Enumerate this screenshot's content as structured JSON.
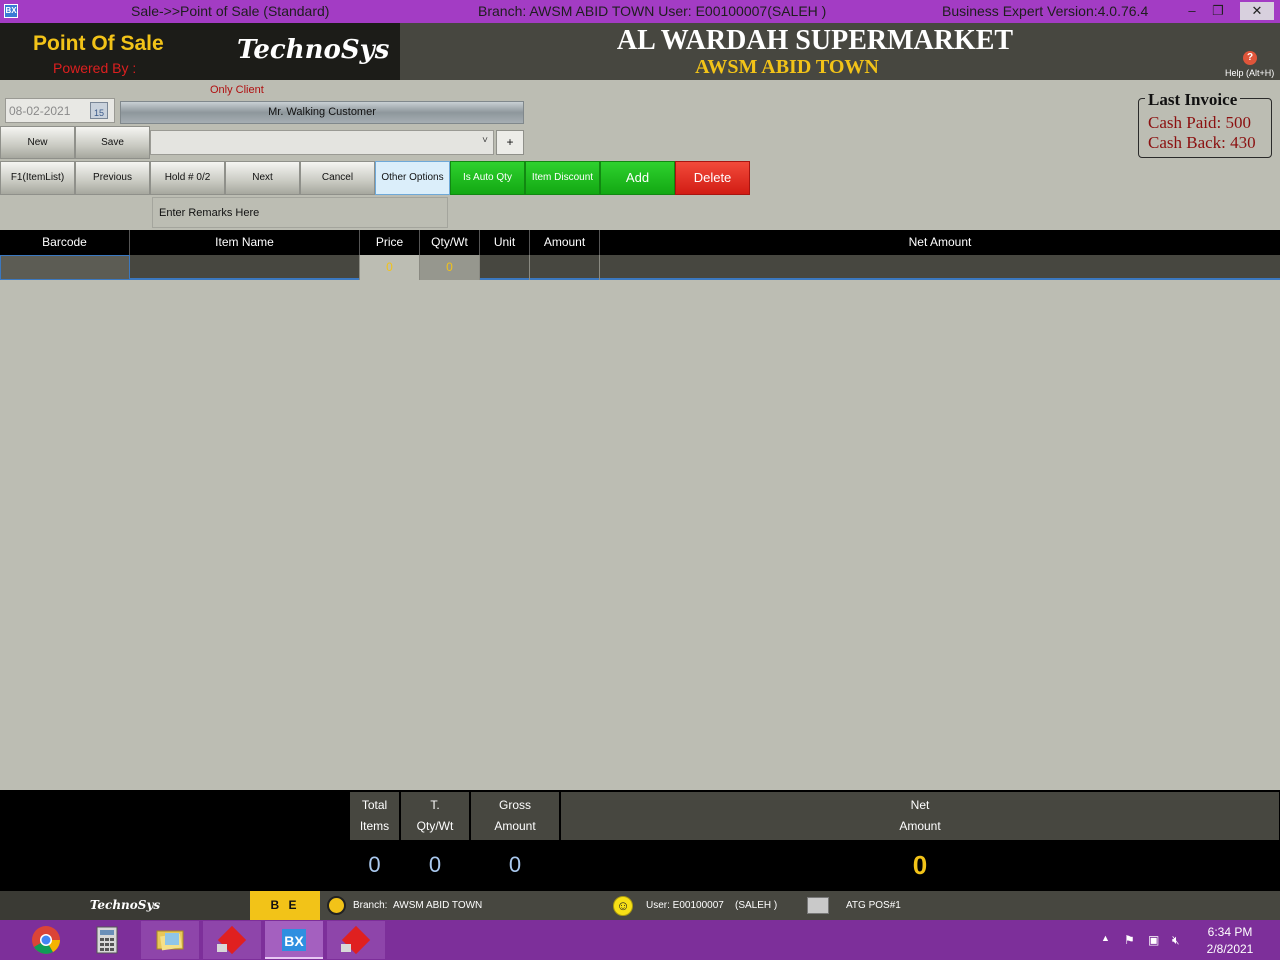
{
  "window": {
    "title": "Sale->>Point of Sale (Standard)",
    "branch_user": "Branch: AWSM ABID TOWN  User: E00100007(SALEH    )",
    "version": "Business Expert Version:4.0.76.4",
    "minimize": "–",
    "restore": "❐",
    "close": "✕"
  },
  "header": {
    "pos_title": "Point Of Sale",
    "powered_by": "Powered By :",
    "logo_text": "TechnoSys",
    "store_name": "AL WARDAH SUPERMARKET",
    "branch_name": "AWSM ABID TOWN",
    "help_label": "Help (Alt+H)",
    "help_icon": "?"
  },
  "form": {
    "only_client": "Only Client",
    "date": "08-02-2021",
    "calendar_icon": "15",
    "customer": "Mr. Walking Customer",
    "combo_value": "",
    "combo_arrow": "˅",
    "plus": "+",
    "remarks_placeholder": "Enter Remarks Here"
  },
  "buttons": {
    "new": "New",
    "save": "Save",
    "f1": "F1(ItemList)",
    "previous": "Previous",
    "hold": "Hold # 0/2",
    "next": "Next",
    "cancel": "Cancel",
    "other_options": "Other Options",
    "auto_qty": "Is Auto Qty",
    "item_discount": "Item Discount",
    "add": "Add",
    "delete": "Delete"
  },
  "last_invoice": {
    "title": "Last Invoice",
    "cash_paid": "Cash Paid: 500",
    "cash_back": "Cash Back: 430"
  },
  "grid": {
    "columns": [
      "Barcode",
      "Item Name",
      "Price",
      "Qty/Wt",
      "Unit",
      "Amount",
      "Net Amount"
    ],
    "row": [
      "",
      "",
      "0",
      "0",
      "",
      "",
      ""
    ]
  },
  "totals": {
    "total_items_l1": "Total",
    "total_items_l2": "Items",
    "t_qty_l1": "T.",
    "t_qty_l2": "Qty/Wt",
    "gross_l1": "Gross",
    "gross_l2": "Amount",
    "net_l1": "Net",
    "net_l2": "Amount",
    "total_items": "0",
    "t_qty": "0",
    "gross_amount": "0",
    "net_amount": "0"
  },
  "statusbar": {
    "logo": "TechnoSys",
    "be": "B E",
    "branch_label": "Branch:",
    "branch": "AWSM ABID TOWN",
    "user": "User: E00100007",
    "user_name": "(SALEH     )",
    "pos": "ATG POS#1"
  },
  "taskbar": {
    "time": "6:34 PM",
    "date": "2/8/2021"
  },
  "colors": {
    "accent_yellow": "#f2c318",
    "green_button": "#13a813",
    "red_button": "#d21c14",
    "titlebar": "#a33cc4",
    "taskbar": "#7d2f9a"
  }
}
